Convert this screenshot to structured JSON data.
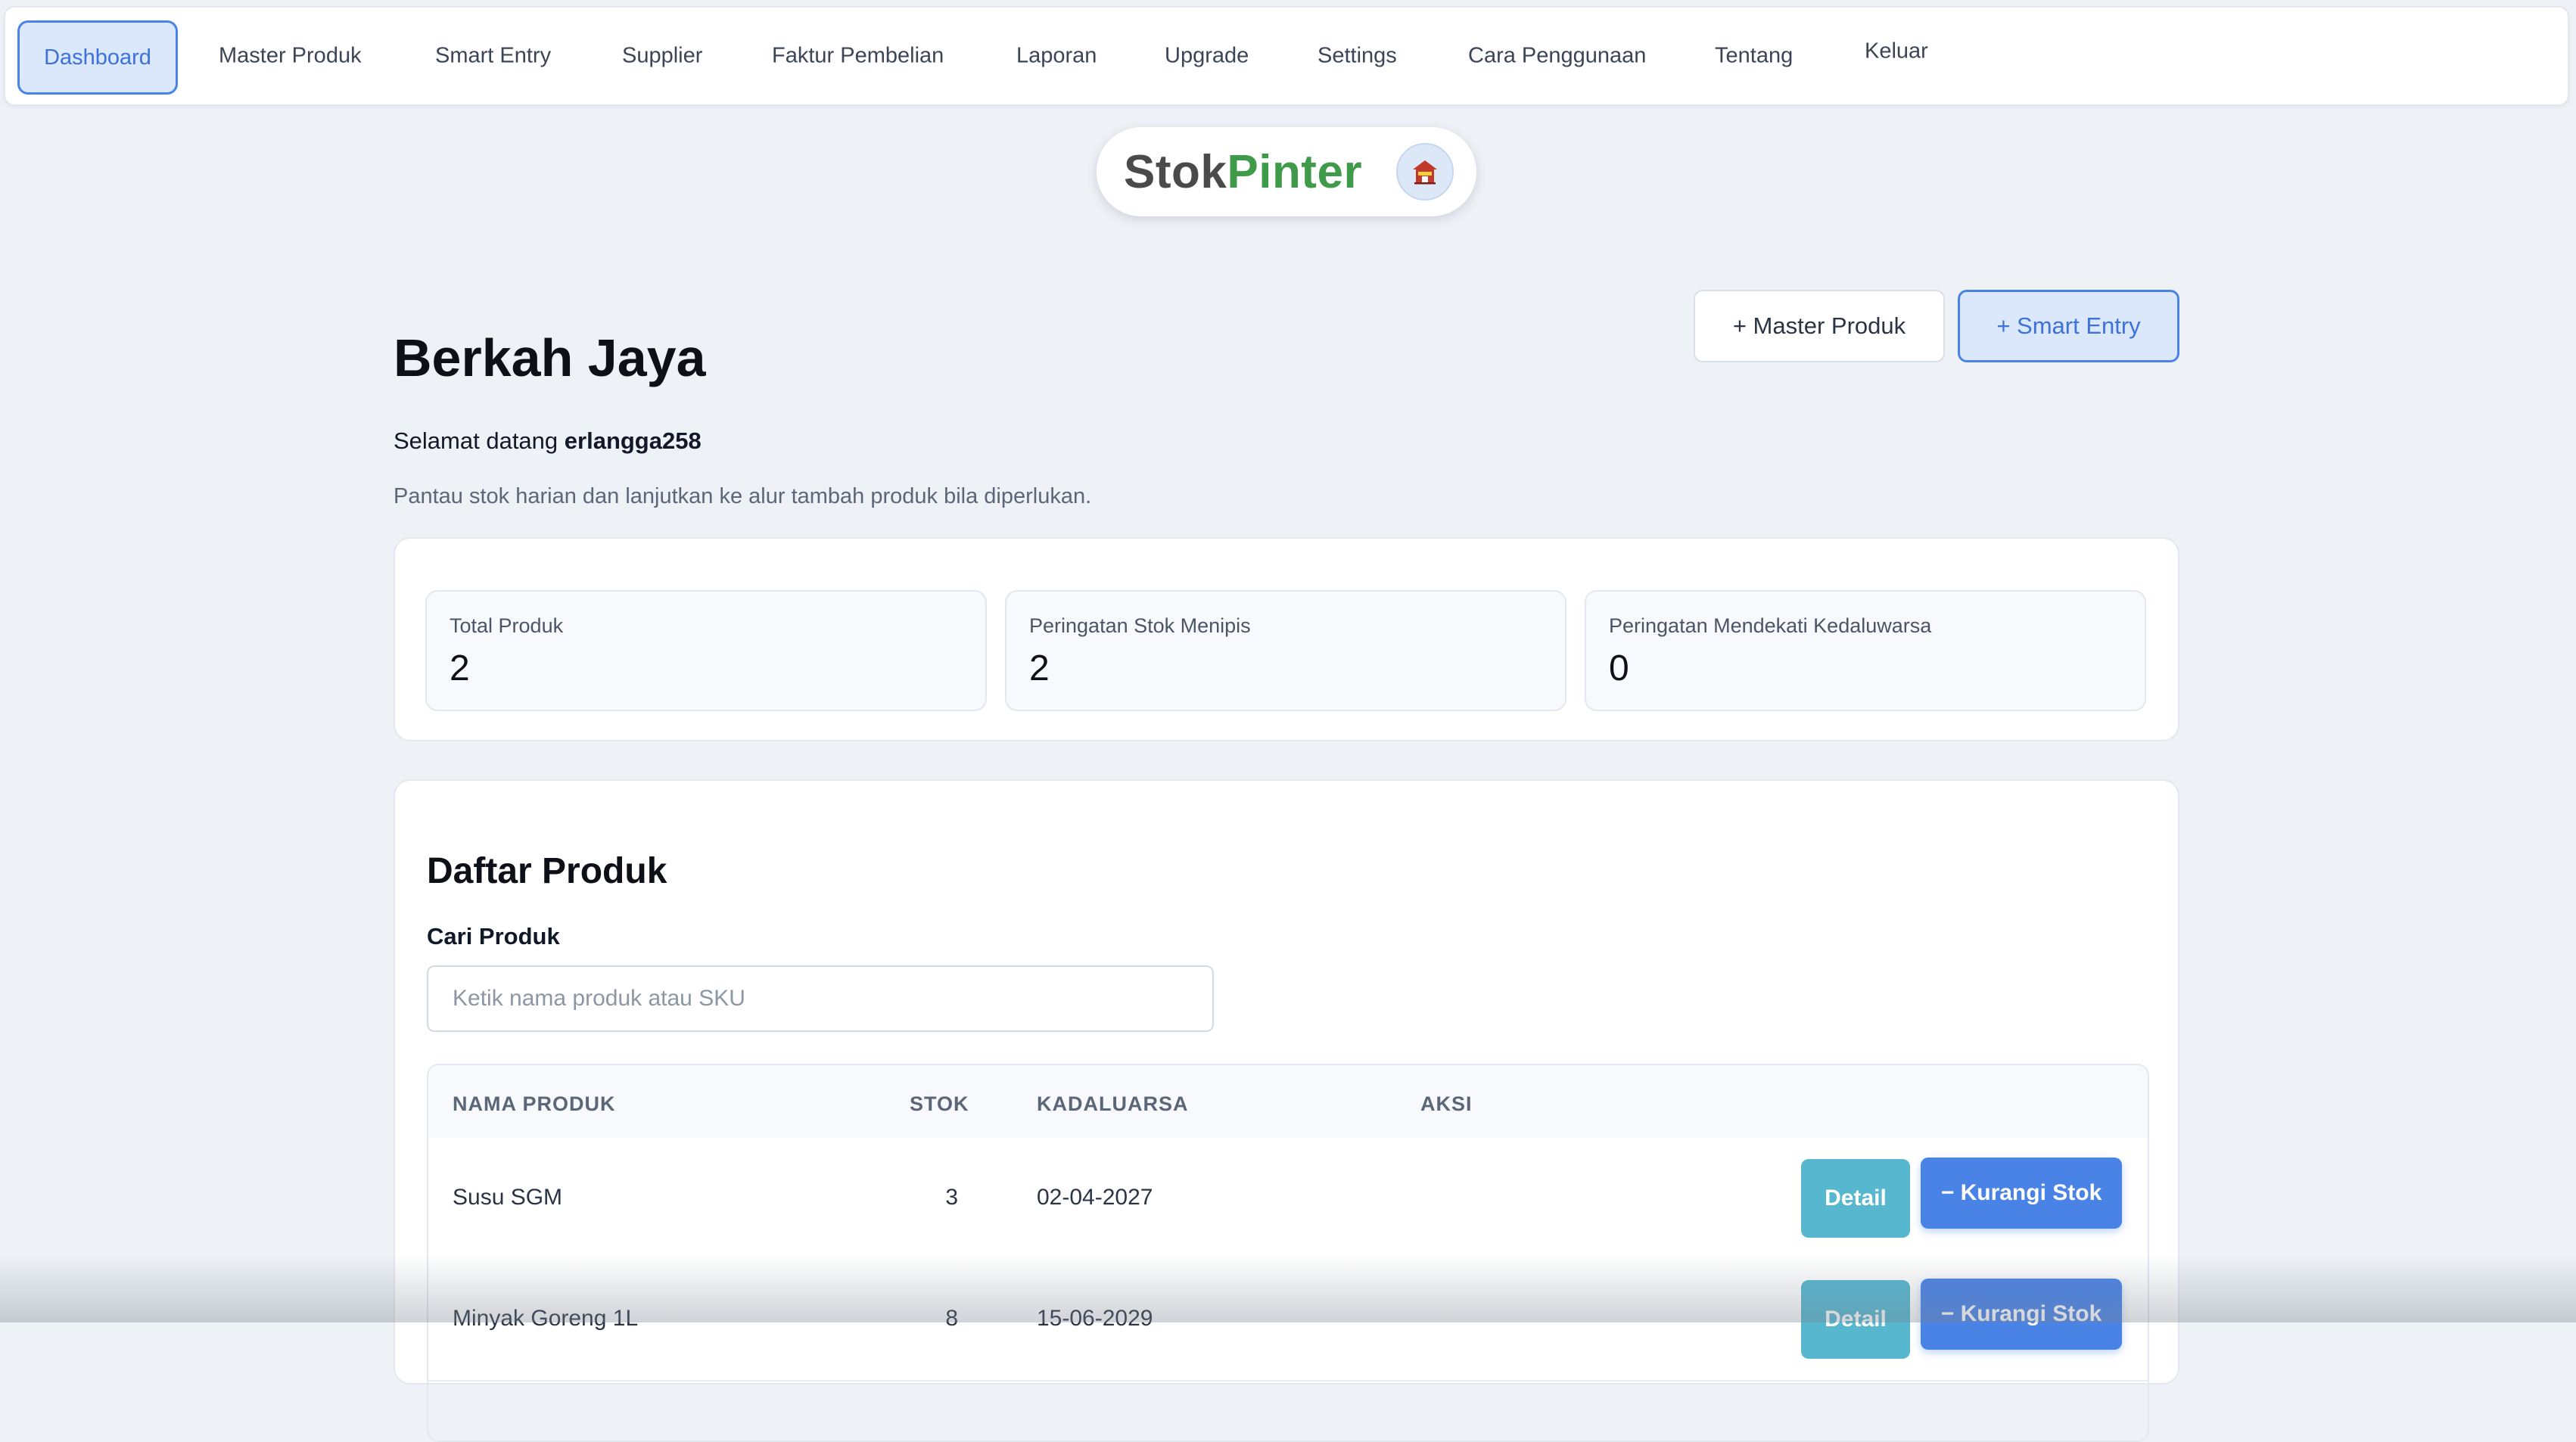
{
  "nav": {
    "items": [
      {
        "label": "Dashboard",
        "active": true
      },
      {
        "label": "Master Produk"
      },
      {
        "label": "Smart Entry"
      },
      {
        "label": "Supplier"
      },
      {
        "label": "Faktur Pembelian"
      },
      {
        "label": "Laporan"
      },
      {
        "label": "Upgrade"
      },
      {
        "label": "Settings"
      },
      {
        "label": "Cara Penggunaan"
      },
      {
        "label": "Tentang"
      },
      {
        "label": "Keluar"
      }
    ]
  },
  "brand": {
    "part1": "Stok",
    "part2": "Pinter",
    "icon": "store-icon",
    "colors": {
      "part1": "#4a4a4a",
      "part2": "#3f9a4a"
    }
  },
  "header": {
    "store_name": "Berkah Jaya",
    "welcome_prefix": "Selamat datang",
    "username": "erlangga258",
    "subtitle": "Pantau stok harian dan lanjutkan ke alur tambah produk bila diperlukan.",
    "btn_master": "+ Master Produk",
    "btn_smart": "+ Smart Entry"
  },
  "stats": [
    {
      "label": "Total Produk",
      "value": "2"
    },
    {
      "label": "Peringatan Stok Menipis",
      "value": "2"
    },
    {
      "label": "Peringatan Mendekati Kedaluwarsa",
      "value": "0"
    }
  ],
  "products": {
    "title": "Daftar Produk",
    "search_label": "Cari Produk",
    "search_placeholder": "Ketik nama produk atau SKU",
    "search_value": "",
    "columns": {
      "name": "NAMA PRODUK",
      "stock": "STOK",
      "expiry": "KADALUARSA",
      "action": "AKSI"
    },
    "rows": [
      {
        "name": "Susu SGM",
        "stock": "3",
        "expiry": "02-04-2027",
        "detail": "Detail",
        "reduce": "− Kurangi Stok"
      },
      {
        "name": "Minyak Goreng 1L",
        "stock": "8",
        "expiry": "15-06-2029",
        "detail": "Detail",
        "reduce": "− Kurangi Stok"
      }
    ]
  },
  "theme": {
    "accent": "#4a83e6",
    "accent_soft": "#dbe7fb",
    "detail_button": "#56b7cf",
    "background": "#eef2f7"
  }
}
